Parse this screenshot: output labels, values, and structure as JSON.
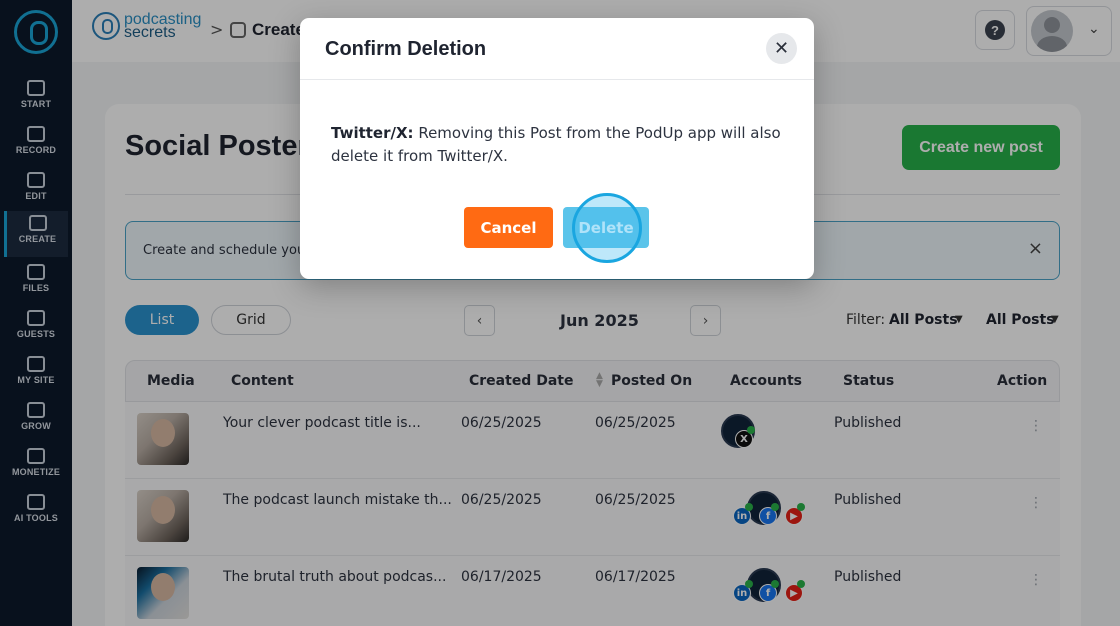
{
  "sidebar": {
    "items": [
      {
        "label": "START",
        "icon": "studio-icon"
      },
      {
        "label": "RECORD",
        "icon": "microphone-icon"
      },
      {
        "label": "EDIT",
        "icon": "edit-icon"
      },
      {
        "label": "CREATE",
        "icon": "create-icon",
        "active": true
      },
      {
        "label": "FILES",
        "icon": "files-icon"
      },
      {
        "label": "GUESTS",
        "icon": "guests-icon"
      },
      {
        "label": "MY SITE",
        "icon": "website-icon"
      },
      {
        "label": "GROW",
        "icon": "chart-icon"
      },
      {
        "label": "MONETIZE",
        "icon": "monetize-icon"
      },
      {
        "label": "AI TOOLS",
        "icon": "ai-icon"
      }
    ]
  },
  "header": {
    "brand_line1": "podcasting",
    "brand_line2": "secrets",
    "breadcrumb_sep": ">",
    "breadcrumb_label": "Create",
    "help_glyph": "?",
    "chevron": "⌄"
  },
  "main": {
    "title": "Social Poster",
    "create_button": "Create new post",
    "banner_text": "Create and schedule your s",
    "banner_close": "×",
    "views": [
      "List",
      "Grid"
    ],
    "month": "Jun 2025",
    "prev": "‹",
    "next": "›",
    "filter_label": "Filter:",
    "filter_value": "All Posts",
    "filter2_value": "All Posts",
    "caret": "▼",
    "columns": [
      "Media",
      "Content",
      "Created Date",
      "Posted On",
      "Accounts",
      "Status",
      "Action"
    ],
    "rows": [
      {
        "content": "Your clever podcast title is...",
        "created": "06/25/2025",
        "posted": "06/25/2025",
        "status": "Published",
        "accounts": [
          "x"
        ]
      },
      {
        "content": "The podcast launch mistake th...",
        "created": "06/25/2025",
        "posted": "06/25/2025",
        "status": "Published",
        "accounts": [
          "linkedin",
          "facebook",
          "youtube"
        ]
      },
      {
        "content": "The brutal truth about podcas...",
        "created": "06/17/2025",
        "posted": "06/17/2025",
        "status": "Published",
        "accounts": [
          "linkedin",
          "facebook",
          "youtube"
        ]
      }
    ],
    "kebab": "⋮"
  },
  "modal": {
    "title": "Confirm Deletion",
    "close": "✕",
    "body_bold": "Twitter/X:",
    "body_text": " Removing this Post from the PodUp app will also delete it from Twitter/X.",
    "cancel": "Cancel",
    "delete": "Delete"
  },
  "colors": {
    "sidebar": "#0c1a2b",
    "accent": "#1aa6d8",
    "create_green": "#27b24a",
    "cancel_orange": "#ff6a13",
    "delete_blue": "#5bc4ea"
  }
}
